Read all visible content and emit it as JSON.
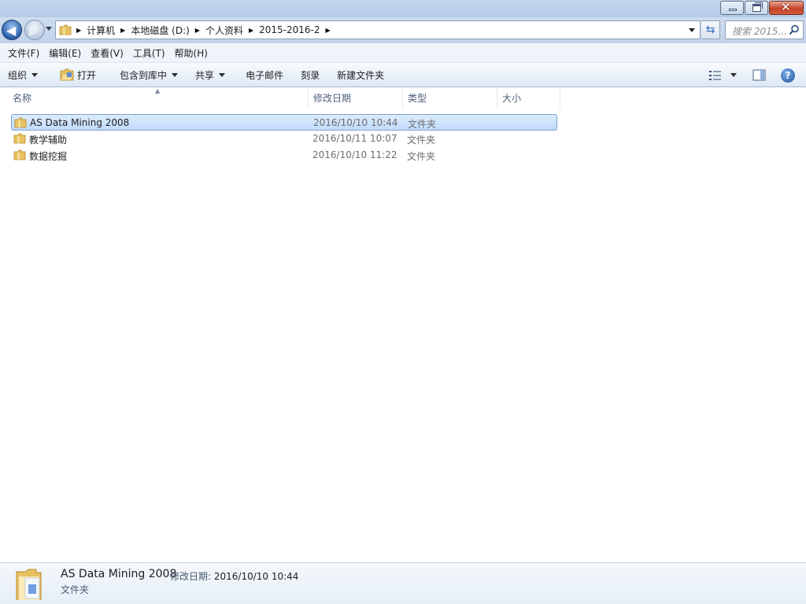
{
  "address": {
    "crumbs": [
      "计算机",
      "本地磁盘 (D:)",
      "个人资料",
      "2015-2016-2"
    ]
  },
  "search": {
    "placeholder": "搜索 2015..."
  },
  "menu": {
    "items": [
      "文件(F)",
      "编辑(E)",
      "查看(V)",
      "工具(T)",
      "帮助(H)"
    ]
  },
  "toolbar": {
    "organize": "组织",
    "open": "打开",
    "include_library": "包含到库中",
    "share": "共享",
    "email": "电子邮件",
    "burn": "刻录",
    "new_folder": "新建文件夹"
  },
  "columns": {
    "name": "名称",
    "date": "修改日期",
    "type": "类型",
    "size": "大小"
  },
  "files": [
    {
      "name": "AS Data Mining 2008",
      "date": "2016/10/10 10:44",
      "type": "文件夹",
      "size": ""
    },
    {
      "name": "教学辅助",
      "date": "2016/10/11 10:07",
      "type": "文件夹",
      "size": ""
    },
    {
      "name": "数据挖掘",
      "date": "2016/10/10 11:22",
      "type": "文件夹",
      "size": ""
    }
  ],
  "details": {
    "name": "AS Data Mining 2008",
    "date_label": "修改日期:",
    "date_value": "2016/10/10 10:44",
    "type": "文件夹"
  },
  "colors": {
    "selection": "#c1dcfc",
    "folder": "#e8c160",
    "accent": "#2a5ea9"
  }
}
